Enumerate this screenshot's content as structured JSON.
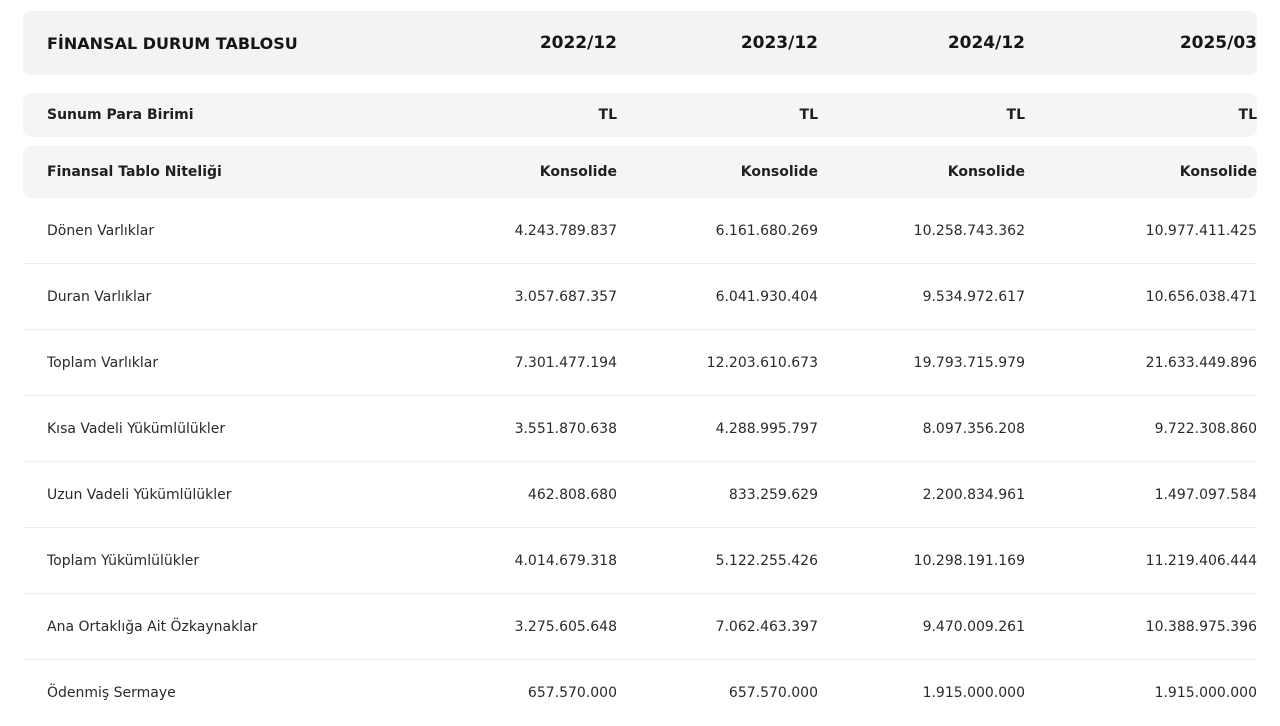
{
  "table": {
    "title": "FİNANSAL DURUM TABLOSU",
    "periods": [
      "2022/12",
      "2023/12",
      "2024/12",
      "2025/03"
    ],
    "meta_rows": [
      {
        "label": "Sunum Para Birimi",
        "values": [
          "TL",
          "TL",
          "TL",
          "TL"
        ]
      },
      {
        "label": "Finansal Tablo Niteliği",
        "values": [
          "Konsolide",
          "Konsolide",
          "Konsolide",
          "Konsolide"
        ]
      }
    ],
    "rows": [
      {
        "label": "Dönen Varlıklar",
        "values": [
          "4.243.789.837",
          "6.161.680.269",
          "10.258.743.362",
          "10.977.411.425"
        ]
      },
      {
        "label": "Duran Varlıklar",
        "values": [
          "3.057.687.357",
          "6.041.930.404",
          "9.534.972.617",
          "10.656.038.471"
        ]
      },
      {
        "label": "Toplam Varlıklar",
        "values": [
          "7.301.477.194",
          "12.203.610.673",
          "19.793.715.979",
          "21.633.449.896"
        ]
      },
      {
        "label": "Kısa Vadeli Yükümlülükler",
        "values": [
          "3.551.870.638",
          "4.288.995.797",
          "8.097.356.208",
          "9.722.308.860"
        ]
      },
      {
        "label": "Uzun Vadeli Yükümlülükler",
        "values": [
          "462.808.680",
          "833.259.629",
          "2.200.834.961",
          "1.497.097.584"
        ]
      },
      {
        "label": "Toplam Yükümlülükler",
        "values": [
          "4.014.679.318",
          "5.122.255.426",
          "10.298.191.169",
          "11.219.406.444"
        ]
      },
      {
        "label": "Ana Ortaklığa Ait Özkaynaklar",
        "values": [
          "3.275.605.648",
          "7.062.463.397",
          "9.470.009.261",
          "10.388.975.396"
        ]
      },
      {
        "label": "Ödenmiş Sermaye",
        "values": [
          "657.570.000",
          "657.570.000",
          "1.915.000.000",
          "1.915.000.000"
        ]
      }
    ]
  }
}
